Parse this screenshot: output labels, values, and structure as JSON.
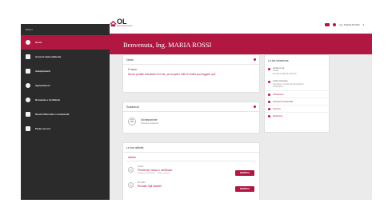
{
  "sidebar": {
    "heading": "MENU",
    "items": [
      {
        "label": "Home",
        "icon": "home-icon"
      },
      {
        "label": "Accessi nata ambiente",
        "icon": "user-icon"
      },
      {
        "label": "Adempimenti",
        "icon": "docs-icon"
      },
      {
        "label": "Agevolazioni",
        "icon": "coins-icon"
      },
      {
        "label": "Domande e Certificati",
        "icon": "doc-check-icon"
      },
      {
        "label": "Servizi Riservati e comunicati",
        "icon": "lock-icon"
      },
      {
        "label": "Parla con noi",
        "icon": "chat-icon"
      }
    ]
  },
  "header": {
    "logo_text": "OL",
    "logo_sub": "INARCASSA ONLINE",
    "user_label": "Ing. MARIA ROSSI"
  },
  "banner": {
    "title": "Benvenuta, Ing. MARIA ROSSI"
  },
  "news": {
    "title": "News",
    "count": "Ci sono",
    "text": "Nuovo portale inarcassa On Line, per scoprire tutte le novità puoi leggere qui!"
  },
  "scadenze": {
    "title": "Scadenze",
    "item_title": "Dichiarazione",
    "item_sub": "Nessuna scadenza"
  },
  "attivita": {
    "title": "Le tue attività",
    "tab": "Attività",
    "rows": [
      {
        "code": "Ac-Ref",
        "title": "Pendenze cassa e certificato",
        "date": "Scadenza 30/11/2018",
        "status": "Stato: In Bozza",
        "button": "MODIFICA"
      },
      {
        "code": "RC-4020",
        "title": "Riscatto figli disabili",
        "date": "",
        "status": "",
        "button": "MODIFICA"
      }
    ]
  },
  "sidepanel": {
    "title": "La tua situazione",
    "items": [
      {
        "head": "Iscrizione Ing.",
        "lines": [
          "Iscritta",
          "Inserisci la data di iscrizione"
        ]
      },
      {
        "head": "Codice Inarcassa",
        "lines": [
          "Alternative: Inserisci la tua posizione",
          "contributiva"
        ]
      }
    ],
    "links": [
      "Dichiarazioni",
      "Posizione Previdenziale",
      "Pensione",
      "Ripartizione"
    ]
  },
  "colors": {
    "accent": "#b01842",
    "sidebar": "#2b2b2b"
  }
}
